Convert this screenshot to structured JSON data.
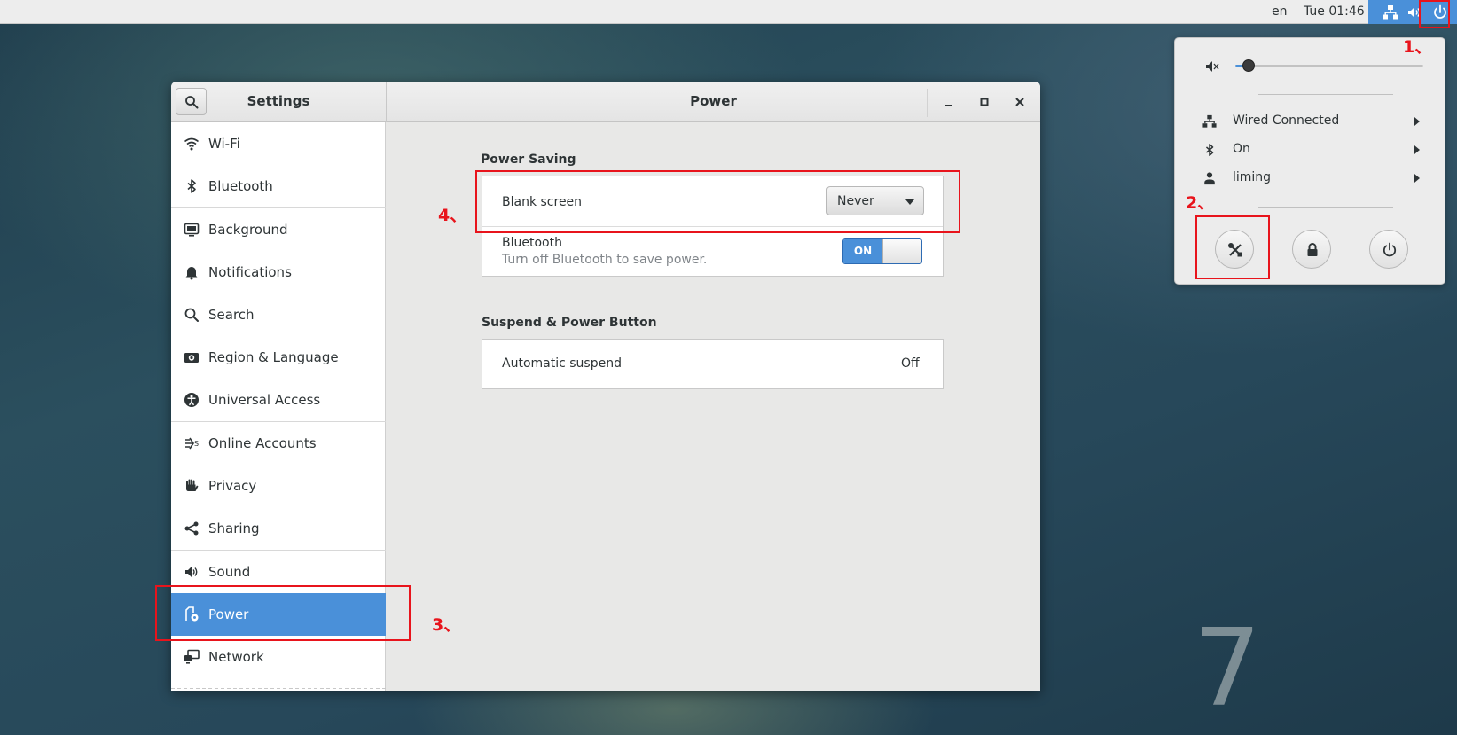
{
  "topbar": {
    "lang": "en",
    "clock": "Tue 01:46",
    "icons": [
      "network-icon",
      "volume-icon",
      "power-icon"
    ]
  },
  "window": {
    "left_title": "Settings",
    "title": "Power",
    "controls": [
      "minimize-icon",
      "maximize-icon",
      "close-icon"
    ]
  },
  "sidebar": {
    "items": [
      {
        "label": "Wi-Fi",
        "icon": "wifi-icon"
      },
      {
        "label": "Bluetooth",
        "icon": "bluetooth-icon"
      },
      {
        "label": "Background",
        "icon": "background-icon"
      },
      {
        "label": "Notifications",
        "icon": "bell-icon"
      },
      {
        "label": "Search",
        "icon": "search-icon"
      },
      {
        "label": "Region & Language",
        "icon": "camera-icon"
      },
      {
        "label": "Universal Access",
        "icon": "accessibility-icon"
      },
      {
        "label": "Online Accounts",
        "icon": "online-accounts-icon"
      },
      {
        "label": "Privacy",
        "icon": "hand-icon"
      },
      {
        "label": "Sharing",
        "icon": "share-icon"
      },
      {
        "label": "Sound",
        "icon": "speaker-icon"
      },
      {
        "label": "Power",
        "icon": "power-settings-icon",
        "selected": true
      },
      {
        "label": "Network",
        "icon": "network-icon"
      }
    ]
  },
  "power": {
    "saving_title": "Power Saving",
    "blank_screen_label": "Blank screen",
    "blank_screen_value": "Never",
    "bluetooth_label": "Bluetooth",
    "bluetooth_sub": "Turn off Bluetooth to save power.",
    "bluetooth_toggle": "ON",
    "suspend_title": "Suspend & Power Button",
    "auto_suspend_label": "Automatic suspend",
    "auto_suspend_value": "Off"
  },
  "system_menu": {
    "volume_level": 0.07,
    "items": [
      {
        "label": "Wired Connected",
        "icon": "wired-network-icon"
      },
      {
        "label": "On",
        "icon": "bluetooth-icon"
      },
      {
        "label": "liming",
        "icon": "user-icon"
      }
    ],
    "buttons": [
      "settings-icon",
      "lock-icon",
      "power-icon"
    ]
  },
  "annotations": [
    "1、",
    "2、",
    "3、",
    "4、"
  ],
  "wallpaper_text": "7",
  "colors": {
    "accent": "#4a90d9",
    "annotation_red": "#e8141c"
  }
}
